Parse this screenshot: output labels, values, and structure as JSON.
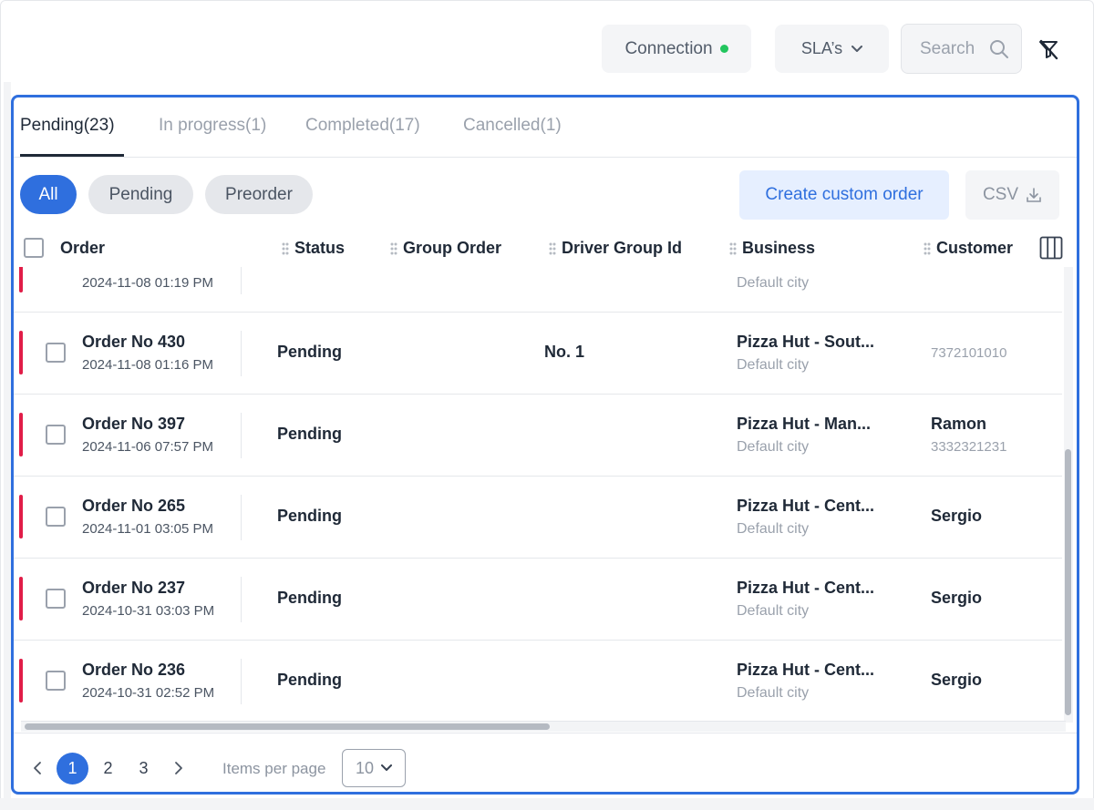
{
  "topbar": {
    "connection_label": "Connection",
    "sla_label": "SLA’s",
    "search_placeholder": "Search",
    "colors": {
      "online": "#22c55e",
      "accent": "#2f6fde"
    }
  },
  "tabs": [
    {
      "label": "Pending(23)",
      "active": true
    },
    {
      "label": "In progress(1)",
      "active": false
    },
    {
      "label": "Completed(17)",
      "active": false
    },
    {
      "label": "Cancelled(1)",
      "active": false
    }
  ],
  "filters": [
    {
      "label": "All",
      "active": true
    },
    {
      "label": "Pending",
      "active": false
    },
    {
      "label": "Preorder",
      "active": false
    }
  ],
  "actions": {
    "create_label": "Create custom order",
    "csv_label": "CSV"
  },
  "columns": {
    "order": "Order",
    "status": "Status",
    "group_order": "Group Order",
    "driver_group_id": "Driver Group Id",
    "business": "Business",
    "customer": "Customer"
  },
  "partial_row": {
    "date": "2024-11-08 01:19 PM",
    "business_city": "Default city"
  },
  "rows": [
    {
      "order_no": "Order No 430",
      "date": "2024-11-08 01:16 PM",
      "status": "Pending",
      "driver_group": "No. 1",
      "business_name": "Pizza Hut - Sout...",
      "business_city": "Default city",
      "customer_name": "",
      "customer_phone": "7372101010"
    },
    {
      "order_no": "Order No 397",
      "date": "2024-11-06 07:57 PM",
      "status": "Pending",
      "driver_group": "",
      "business_name": "Pizza Hut - Man...",
      "business_city": "Default city",
      "customer_name": "Ramon",
      "customer_phone": "3332321231"
    },
    {
      "order_no": "Order No 265",
      "date": "2024-11-01 03:05 PM",
      "status": "Pending",
      "driver_group": "",
      "business_name": "Pizza Hut - Cent...",
      "business_city": "Default city",
      "customer_name": "Sergio",
      "customer_phone": ""
    },
    {
      "order_no": "Order No 237",
      "date": "2024-10-31 03:03 PM",
      "status": "Pending",
      "driver_group": "",
      "business_name": "Pizza Hut - Cent...",
      "business_city": "Default city",
      "customer_name": "Sergio",
      "customer_phone": ""
    },
    {
      "order_no": "Order No 236",
      "date": "2024-10-31 02:52 PM",
      "status": "Pending",
      "driver_group": "",
      "business_name": "Pizza Hut - Cent...",
      "business_city": "Default city",
      "customer_name": "Sergio",
      "customer_phone": ""
    }
  ],
  "pagination": {
    "pages": [
      "1",
      "2",
      "3"
    ],
    "current": "1",
    "items_per_page_label": "Items per page",
    "items_per_page_value": "10"
  }
}
